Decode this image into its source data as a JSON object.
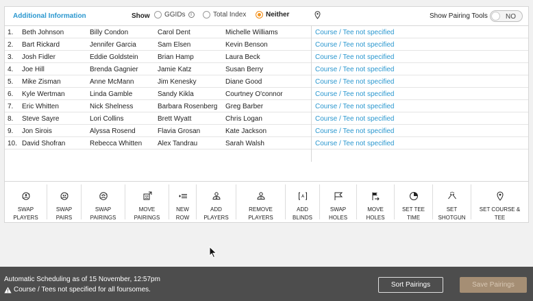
{
  "header": {
    "additional_info": "Additional Information",
    "show_label": "Show",
    "options": [
      {
        "label": "GGIDs",
        "selected": false
      },
      {
        "label": "Total Index",
        "selected": false
      },
      {
        "label": "Neither",
        "selected": true
      }
    ],
    "pairing_tools_label": "Show Pairing Tools",
    "pairing_tools_toggle": "NO"
  },
  "pairings": [
    {
      "num": "1.",
      "p1": "Beth Johnson",
      "p2": "Billy Condon",
      "p3": "Carol Dent",
      "p4": "Michelle Williams",
      "course": "Course / Tee not specified"
    },
    {
      "num": "2.",
      "p1": "Bart Rickard",
      "p2": "Jennifer Garcia",
      "p3": "Sam Elsen",
      "p4": "Kevin Benson",
      "course": "Course / Tee not specified"
    },
    {
      "num": "3.",
      "p1": "Josh Fidler",
      "p2": "Eddie Goldstein",
      "p3": "Brian Hamp",
      "p4": "Laura Beck",
      "course": "Course / Tee not specified"
    },
    {
      "num": "4.",
      "p1": "Joe Hill",
      "p2": "Brenda Gagnier",
      "p3": "Jamie Katz",
      "p4": "Susan Berry",
      "course": "Course / Tee not specified"
    },
    {
      "num": "5.",
      "p1": "Mike Zisman",
      "p2": "Anne McMann",
      "p3": "Jim Kenesky",
      "p4": "Diane Good",
      "course": "Course / Tee not specified"
    },
    {
      "num": "6.",
      "p1": "Kyle Wertman",
      "p2": "Linda Gamble",
      "p3": "Sandy Kikla",
      "p4": "Courtney O'connor",
      "course": "Course / Tee not specified"
    },
    {
      "num": "7.",
      "p1": "Eric Whitten",
      "p2": "Nick Shelness",
      "p3": "Barbara Rosenberg",
      "p4": "Greg Barber",
      "course": "Course / Tee not specified"
    },
    {
      "num": "8.",
      "p1": "Steve Sayre",
      "p2": "Lori Collins",
      "p3": "Brett Wyatt",
      "p4": "Chris Logan",
      "course": "Course / Tee not specified"
    },
    {
      "num": "9.",
      "p1": "Jon Sirois",
      "p2": "Alyssa Rosend",
      "p3": "Flavia Grosan",
      "p4": "Kate Jackson",
      "course": "Course / Tee not specified"
    },
    {
      "num": "10.",
      "p1": "David Shofran",
      "p2": "Rebecca Whitten",
      "p3": "Alex Tandrau",
      "p4": "Sarah Walsh",
      "course": "Course / Tee not specified"
    }
  ],
  "toolbar": [
    {
      "id": "swap-players",
      "line1": "Swap",
      "line2": "Players",
      "icon": "swap-players-icon"
    },
    {
      "id": "swap-pairs",
      "line1": "Swap",
      "line2": "Pairs",
      "icon": "swap-pairs-icon"
    },
    {
      "id": "swap-pairings",
      "line1": "Swap",
      "line2": "Pairings",
      "icon": "swap-pairings-icon"
    },
    {
      "id": "move-pairings",
      "line1": "Move",
      "line2": "Pairings",
      "icon": "move-pairings-icon"
    },
    {
      "id": "new-row",
      "line1": "New",
      "line2": "Row",
      "icon": "new-row-icon"
    },
    {
      "id": "add-players",
      "line1": "Add",
      "line2": "Players",
      "icon": "add-player-icon"
    },
    {
      "id": "remove-players",
      "line1": "Remove",
      "line2": "Players",
      "icon": "remove-player-icon"
    },
    {
      "id": "add-blinds",
      "line1": "Add",
      "line2": "Blinds",
      "icon": "add-blinds-icon"
    },
    {
      "id": "swap-holes",
      "line1": "Swap",
      "line2": "Holes",
      "icon": "flag-icon"
    },
    {
      "id": "move-holes",
      "line1": "Move",
      "line2": "Holes",
      "icon": "move-flag-icon"
    },
    {
      "id": "set-tee-time",
      "line1": "Set Tee",
      "line2": "Time",
      "icon": "clock-icon"
    },
    {
      "id": "set-shotgun",
      "line1": "Set",
      "line2": "Shotgun",
      "icon": "shotgun-icon"
    },
    {
      "id": "set-course-tee",
      "line1": "Set Course &",
      "line2": "Tee",
      "icon": "location-pin-icon"
    }
  ],
  "footer": {
    "schedule_text": "Automatic Scheduling as of 15 November, 12:57pm",
    "warning_text": "Course / Tees not specified for all foursomes.",
    "sort_button": "Sort Pairings",
    "save_button": "Save Pairings"
  },
  "colors": {
    "accent": "#2a97cf",
    "radio_selected": "#f5961e",
    "footer_bg": "#4d4d4d",
    "save_disabled": "#a58e74"
  }
}
